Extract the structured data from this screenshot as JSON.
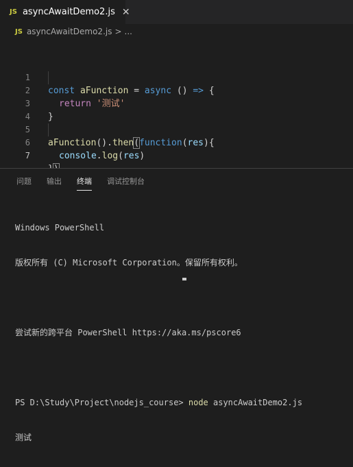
{
  "tab": {
    "icon": "JS",
    "title": "asyncAwaitDemo2.js",
    "close": "✕"
  },
  "breadcrumb": {
    "icon": "JS",
    "file": "asyncAwaitDemo2.js",
    "separator": ">",
    "more": "..."
  },
  "editor": {
    "lines": [
      {
        "num": "1"
      },
      {
        "num": "2"
      },
      {
        "num": "3"
      },
      {
        "num": "4"
      },
      {
        "num": "5"
      },
      {
        "num": "6"
      },
      {
        "num": "7"
      }
    ],
    "tokens": {
      "l1_const": "const",
      "l1_name": "aFunction",
      "l1_eq": " = ",
      "l1_async": "async",
      "l1_parens": " () ",
      "l1_arrow": "=>",
      "l1_brace": " {",
      "l2_return": "return",
      "l2_str": "'测试'",
      "l3_close": "}",
      "l5_call": "aFunction",
      "l5_p": "().",
      "l5_then": "then",
      "l5_open": "(",
      "l5_function": "function",
      "l5_paren_open": "(",
      "l5_res": "res",
      "l5_paren_close": "){",
      "l6_console": "console",
      "l6_dot": ".",
      "l6_log": "log",
      "l6_open": "(",
      "l6_res": "res",
      "l6_close": ")",
      "l7_brace": "}",
      "l7_paren": ")"
    }
  },
  "panel": {
    "tabs": [
      "问题",
      "输出",
      "终端",
      "调试控制台"
    ],
    "active_tab": "终端"
  },
  "terminal": {
    "line1": "Windows PowerShell",
    "line2": "版权所有 (C) Microsoft Corporation。保留所有权利。",
    "line3": "",
    "line4": "尝试新的跨平台 PowerShell https://aka.ms/pscore6",
    "line5": "",
    "prompt": "PS D:\\Study\\Project\\nodejs_course> ",
    "cmd": "node",
    "arg": " asyncAwaitDemo2.js",
    "output": "测试"
  },
  "colors": {
    "background": "#1e1e1e",
    "keyword": "#569cd6",
    "function": "#dcdcaa",
    "string": "#ce9178",
    "control": "#c586c0",
    "variable": "#9cdcfe"
  }
}
